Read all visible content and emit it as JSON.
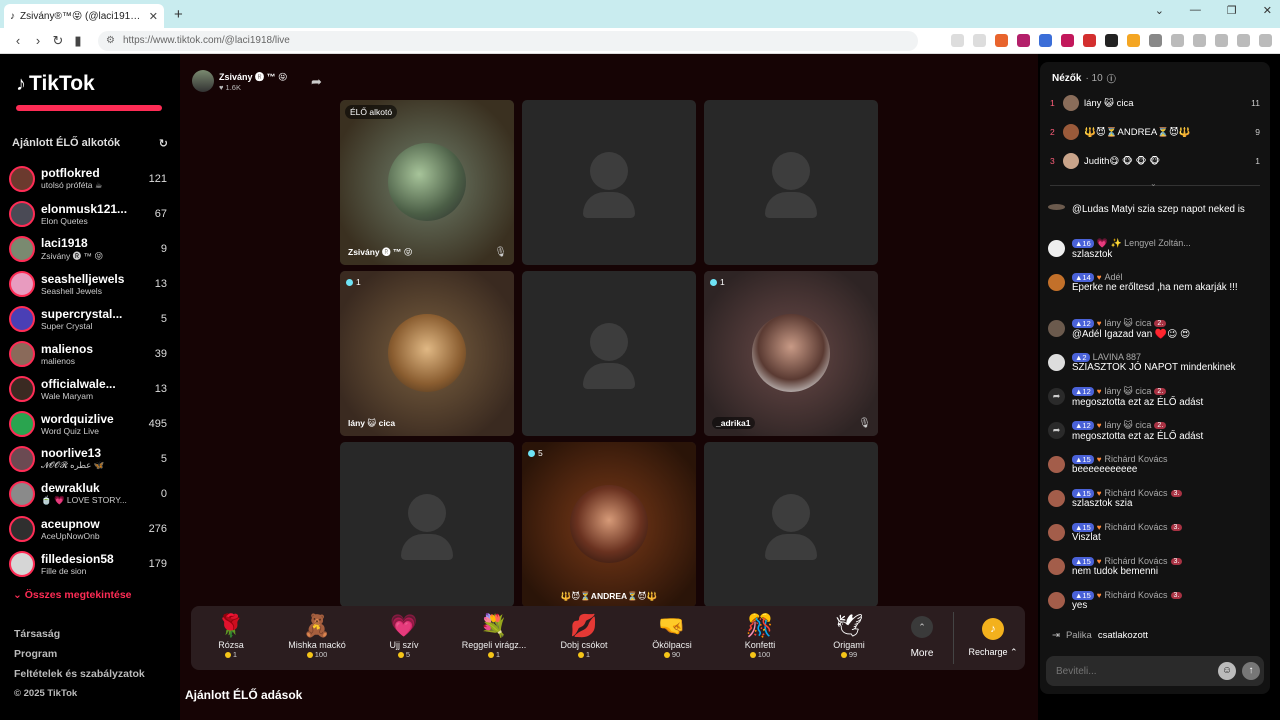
{
  "browser": {
    "tab_title": "Zsivány®™😝 (@laci1918) É...",
    "tab_close": "✕",
    "new_tab": "+",
    "url": "https://www.tiktok.com/@laci1918/live",
    "window_controls": [
      "⌄",
      "—",
      "❐",
      "✕"
    ]
  },
  "sidebar": {
    "logo": "TikTok",
    "section_title": "Ajánlott ÉLŐ alkotók",
    "refresh_icon": "↻",
    "items": [
      {
        "name": "potflokred",
        "sub": "utolsó próféta ☕",
        "count": "121"
      },
      {
        "name": "elonmusk121...",
        "sub": "Elon Quetes",
        "count": "67"
      },
      {
        "name": "laci1918",
        "sub": "Zsivány 🅡 ™ 😝",
        "count": "9"
      },
      {
        "name": "seashelljewels",
        "sub": "Seashell Jewels",
        "count": "13"
      },
      {
        "name": "supercrystal...",
        "sub": "Super Crystal",
        "count": "5"
      },
      {
        "name": "malienos",
        "sub": "malienos",
        "count": "39"
      },
      {
        "name": "officialwale...",
        "sub": "Wale Maryam",
        "count": "13"
      },
      {
        "name": "wordquizlive",
        "sub": "Word Quiz Live",
        "count": "495"
      },
      {
        "name": "noorlive13",
        "sub": "𝓝𝓞𝓞𝓡 عطره 🦋",
        "count": "5"
      },
      {
        "name": "dewrakluk",
        "sub": "🍵 💗 LOVE STORY...",
        "count": "0"
      },
      {
        "name": "aceupnow",
        "sub": "AceUpNowOnb",
        "count": "276"
      },
      {
        "name": "filledesion58",
        "sub": "Fille de sion",
        "count": "179"
      }
    ],
    "show_all": "⌄ Összes megtekintése",
    "links": [
      "Társaság",
      "Program",
      "Feltételek és szabályzatok",
      "© 2025 TikTok"
    ]
  },
  "host": {
    "name": "Zsivány 🅡 ™ 😝",
    "likes": "♥ 1.6K"
  },
  "grid": {
    "host_badge": "ÉLŐ alkotó",
    "host_label": "Zsivány 🅡 ™ 😝",
    "guest1_count": "1",
    "guest1_name": "lány 😺 cica",
    "guest2_count": "1",
    "guest2_name": "_adrika1",
    "guest3_count": "5",
    "guest3_name": "🔱😈⏳ANDREA⏳😈🔱"
  },
  "gifts": [
    {
      "icon": "🌹",
      "label": "Rózsa",
      "price": "1"
    },
    {
      "icon": "🧸",
      "label": "Mishka mackó",
      "price": "100"
    },
    {
      "icon": "💗",
      "label": "Ujj szív",
      "price": "5"
    },
    {
      "icon": "💐",
      "label": "Reggeli virágz...",
      "price": "1"
    },
    {
      "icon": "💋",
      "label": "Dobj csókot",
      "price": "1"
    },
    {
      "icon": "🤜",
      "label": "Ökölpacsi",
      "price": "90"
    },
    {
      "icon": "🎊",
      "label": "Konfetti",
      "price": "100"
    },
    {
      "icon": "🕊",
      "label": "Origami",
      "price": "99"
    }
  ],
  "gift_bar": {
    "more_label": "More",
    "recharge_label": "Recharge ⌃"
  },
  "recommended_title": "Ajánlott ÉLŐ adások",
  "chat": {
    "viewers_title": "Nézők",
    "viewers_count": "· 10",
    "top_viewers": [
      {
        "rank": "1",
        "name": "lány 😺 cica",
        "score": "11"
      },
      {
        "rank": "2",
        "name": "🔱😈⏳ANDREA⏳😈🔱",
        "score": "9"
      },
      {
        "rank": "3",
        "name": "Judith😋 🐵 🐵 🐵",
        "score": "1"
      }
    ],
    "messages": [
      {
        "head": "",
        "body": "@Ludas Matyi szia szep napot neked is",
        "lvl": "",
        "fan": "",
        "share": false
      },
      {
        "head": "💗 ✨ Lengyel Zoltán...",
        "body": "szlasztok",
        "lvl": "16",
        "fan": "",
        "share": false
      },
      {
        "head": "Adél",
        "body": "Eperke ne erőltesd ,ha nem akarják !!!",
        "lvl": "14",
        "fan": "",
        "share": false
      },
      {
        "head": "lány 😺 cica",
        "body": "@Adél Igazad van ♥️😉 😍",
        "lvl": "12",
        "fan": "2.",
        "share": false
      },
      {
        "head": "LAVINA 887",
        "body": "SZIASZTOK JÓ NAPOT mindenkinek",
        "lvl": "2",
        "fan": "",
        "share": false
      },
      {
        "head": "lány 😺 cica",
        "body": "megosztotta ezt az ÉLŐ adást",
        "lvl": "12",
        "fan": "2.",
        "share": true
      },
      {
        "head": "lány 😺 cica",
        "body": "megosztotta ezt az ÉLŐ adást",
        "lvl": "12",
        "fan": "2.",
        "share": true
      },
      {
        "head": "Richárd Kovács",
        "body": "beeeeeeeeeee",
        "lvl": "15",
        "fan": "",
        "share": false
      },
      {
        "head": "Richárd Kovács",
        "body": "szlasztok szia",
        "lvl": "15",
        "fan": "3.",
        "share": false
      },
      {
        "head": "Richárd Kovács",
        "body": "Viszlat",
        "lvl": "15",
        "fan": "3.",
        "share": false
      },
      {
        "head": "Richárd Kovács",
        "body": "nem tudok bemenni",
        "lvl": "15",
        "fan": "3.",
        "share": false
      },
      {
        "head": "Richárd Kovács",
        "body": "yes",
        "lvl": "15",
        "fan": "3.",
        "share": false
      }
    ],
    "joined_name": "Palika",
    "joined_text": "csatlakozott",
    "input_placeholder": "Beviteli..."
  }
}
